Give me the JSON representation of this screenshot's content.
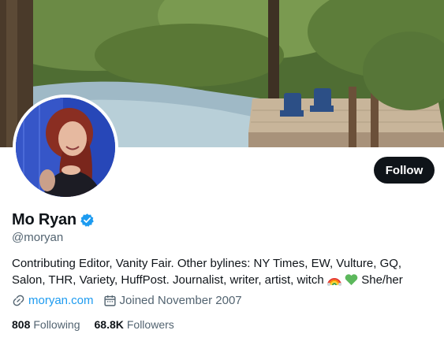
{
  "profile": {
    "display_name": "Mo Ryan",
    "handle": "@moryan",
    "bio_text": "Contributing Editor, Vanity Fair. Other bylines: NY Times, EW, Vulture, GQ, Salon, THR, Variety, HuffPost. Journalist, writer, artist, witch",
    "bio_pronouns": "She/her",
    "bio_emojis": [
      "rainbow-emoji",
      "green-heart-emoji"
    ],
    "verified": true
  },
  "actions": {
    "follow_label": "Follow"
  },
  "meta": {
    "website": "moryan.com",
    "joined": "Joined November 2007"
  },
  "stats": {
    "following_count": "808",
    "following_label": "Following",
    "followers_count": "68.8K",
    "followers_label": "Followers"
  },
  "colors": {
    "accent": "#1d9bf0",
    "text_primary": "#0f1419",
    "text_secondary": "#536471",
    "button_bg": "#0f1419",
    "verified": "#1d9bf0"
  }
}
